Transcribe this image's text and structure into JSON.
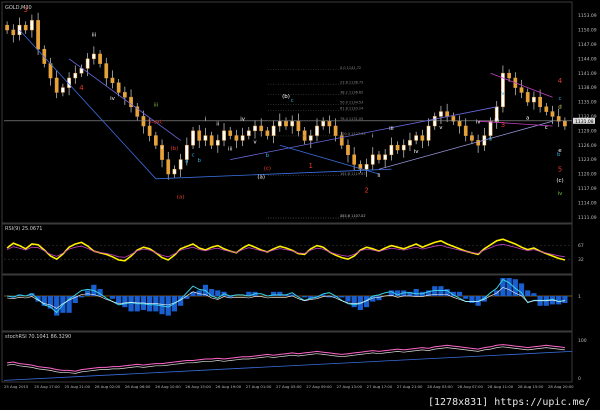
{
  "chart_data": {
    "type": "line",
    "title": "GOLD,M30",
    "symbol": "GOLD",
    "timeframe": "M30",
    "main": {
      "ylim": [
        1110,
        1155
      ],
      "ticks": [
        "1153.09",
        "1150.09",
        "1147.09",
        "1144.09",
        "1141.09",
        "1138.09",
        "1135.09",
        "1132.09",
        "1129.09",
        "1126.09",
        "1123.09",
        "1120.09",
        "1117.09",
        "1114.09",
        "1111.09"
      ],
      "current_price": "1131.08",
      "close": [
        1150,
        1149,
        1151,
        1150,
        1152,
        1146,
        1143,
        1140,
        1137,
        1138,
        1140,
        1141,
        1142,
        1144,
        1145,
        1143,
        1140,
        1139,
        1137,
        1136,
        1134,
        1132,
        1130,
        1128,
        1126,
        1123,
        1120,
        1121,
        1123,
        1126,
        1129,
        1127,
        1128,
        1126,
        1127,
        1129,
        1128,
        1127,
        1128,
        1129,
        1130,
        1129,
        1128,
        1130,
        1131,
        1130,
        1131,
        1129,
        1127,
        1128,
        1130,
        1131,
        1130,
        1128,
        1126,
        1124,
        1122,
        1121,
        1122,
        1124,
        1123,
        1124,
        1126,
        1125,
        1126,
        1127,
        1128,
        1127,
        1130,
        1132,
        1133,
        1132,
        1131,
        1130,
        1128,
        1127,
        1126,
        1128,
        1131,
        1134,
        1141,
        1140,
        1138,
        1137,
        1135,
        1136,
        1134,
        1133,
        1132,
        1131,
        1130
      ]
    },
    "wave_labels": [
      {
        "text": "3",
        "color": "#e03a2a"
      },
      {
        "text": "4",
        "color": "#e03a2a"
      },
      {
        "text": "iii",
        "color": "#ffffff"
      },
      {
        "text": "iv",
        "color": "#ffffff"
      },
      {
        "text": "5-ext.",
        "color": "#e03a2a"
      },
      {
        "text": "iii",
        "color": "#7ec23a"
      },
      {
        "text": "v",
        "color": "#ffffff"
      },
      {
        "text": "(b)",
        "color": "#e03a2a"
      },
      {
        "text": "(a)",
        "color": "#e03a2a"
      },
      {
        "text": "a",
        "color": "#2ea8e0"
      },
      {
        "text": "b",
        "color": "#2ea8e0"
      },
      {
        "text": "c",
        "color": "#2ea8e0"
      },
      {
        "text": "i",
        "color": "#ffffff"
      },
      {
        "text": "ii",
        "color": "#ffffff"
      },
      {
        "text": "iii",
        "color": "#ffffff"
      },
      {
        "text": "iv",
        "color": "#ffffff"
      },
      {
        "text": "v",
        "color": "#ffffff"
      },
      {
        "text": "(a)",
        "color": "#ffffff"
      },
      {
        "text": "(c)",
        "color": "#e03a2a"
      },
      {
        "text": "b",
        "color": "#2ea8e0"
      },
      {
        "text": "(b)",
        "color": "#ffffff"
      },
      {
        "text": "c",
        "color": "#2ea8e0"
      },
      {
        "text": "1",
        "color": "#e03a2a"
      },
      {
        "text": "2",
        "color": "#e03a2a"
      },
      {
        "text": "i",
        "color": "#ffffff"
      },
      {
        "text": "ii",
        "color": "#ffffff"
      },
      {
        "text": "iii",
        "color": "#ffffff"
      },
      {
        "text": "iv",
        "color": "#ffffff"
      },
      {
        "text": "v",
        "color": "#ffffff"
      },
      {
        "text": "3",
        "color": "#e03a2a"
      },
      {
        "text": "iv",
        "color": "#7ec23a"
      },
      {
        "text": "(c)",
        "color": "#ffffff"
      },
      {
        "text": "5",
        "color": "#e03a2a"
      },
      {
        "text": "v",
        "color": "#2ea8e0"
      },
      {
        "text": "a",
        "color": "#ffffff"
      },
      {
        "text": "c",
        "color": "#ffffff"
      },
      {
        "text": "b",
        "color": "#2ea8e0"
      },
      {
        "text": "e",
        "color": "#ffffff"
      },
      {
        "text": "b",
        "color": "#2ea8e0"
      },
      {
        "text": "d",
        "color": "#e0e070"
      },
      {
        "text": "c",
        "color": "#2ea8e0"
      },
      {
        "text": "4",
        "color": "#e03a2a"
      },
      {
        "text": "iii",
        "color": "#ffffff"
      },
      {
        "text": "iv",
        "color": "#ffffff"
      }
    ],
    "fib_levels": [
      "0.0 1141.72",
      "23.6 1138.72",
      "38.2 1136.62",
      "50.0 1134.53",
      "61.8 1133.24",
      "76.4 1131.05",
      "100.0 1127.93",
      "161.8 1119.67",
      "261.8 1107.07",
      "423.6 1107.22"
    ],
    "rsi": {
      "label": "RSI(9) 25.0671",
      "ticks": [
        "67",
        "32"
      ],
      "values": [
        60,
        72,
        66,
        58,
        70,
        68,
        55,
        40,
        32,
        45,
        62,
        70,
        74,
        65,
        52,
        48,
        44,
        38,
        30,
        28,
        40,
        55,
        62,
        58,
        48,
        36,
        30,
        42,
        58,
        64,
        70,
        60,
        55,
        62,
        66,
        58,
        52,
        48,
        60,
        68,
        62,
        55,
        50,
        58,
        64,
        60,
        54,
        46,
        44,
        58,
        66,
        62,
        50,
        42,
        36,
        32,
        40,
        55,
        62,
        58,
        52,
        60,
        66,
        62,
        58,
        64,
        70,
        62,
        68,
        74,
        78,
        70,
        64,
        58,
        52,
        48,
        44,
        58,
        68,
        78,
        82,
        76,
        70,
        62,
        56,
        60,
        52,
        46,
        40,
        34,
        30
      ]
    },
    "macd": {
      "ticks": [
        "1",
        ""
      ]
    },
    "stoch": {
      "label": "stochRSI 70.1041 86.3290",
      "ticks": [
        "100",
        "0"
      ],
      "values": [
        40,
        42,
        38,
        36,
        34,
        30,
        28,
        26,
        22,
        20,
        20,
        18,
        22,
        24,
        26,
        28,
        28,
        30,
        30,
        32,
        34,
        36,
        34,
        36,
        38,
        38,
        40,
        42,
        44,
        46,
        46,
        48,
        50,
        50,
        52,
        50,
        52,
        54,
        56,
        56,
        58,
        60,
        62,
        60,
        62,
        64,
        66,
        64,
        66,
        68,
        70,
        68,
        66,
        64,
        62,
        64,
        66,
        68,
        70,
        72,
        70,
        72,
        74,
        76,
        74,
        76,
        78,
        80,
        78,
        82,
        84,
        86,
        84,
        82,
        80,
        78,
        76,
        80,
        82,
        86,
        88,
        86,
        84,
        82,
        80,
        82,
        84,
        86,
        84,
        82,
        80
      ]
    },
    "x_ticks": [
      "25 Aug 2015",
      "25 Aug 17:00",
      "25 Aug 21:00",
      "26 Aug 02:00",
      "26 Aug 06:00",
      "26 Aug 10:00",
      "26 Aug 15:00",
      "26 Aug 19:00",
      "27 Aug 01:00",
      "27 Aug 05:00",
      "27 Aug 09:00",
      "27 Aug 13:00",
      "27 Aug 17:00",
      "27 Aug 21:00",
      "28 Aug 03:00",
      "28 Aug 07:00",
      "28 Aug 11:00",
      "28 Aug 15:00",
      "28 Aug 20:00"
    ],
    "watermark": "[1278x831] https://upic.me/",
    "colors": {
      "up": "#e8a23a",
      "down": "#e8a23a",
      "wick": "#d0d0d0",
      "rsi": "#ffee00",
      "macd_hist": "#1a5fd0",
      "grid": "#1e1e1e"
    }
  }
}
